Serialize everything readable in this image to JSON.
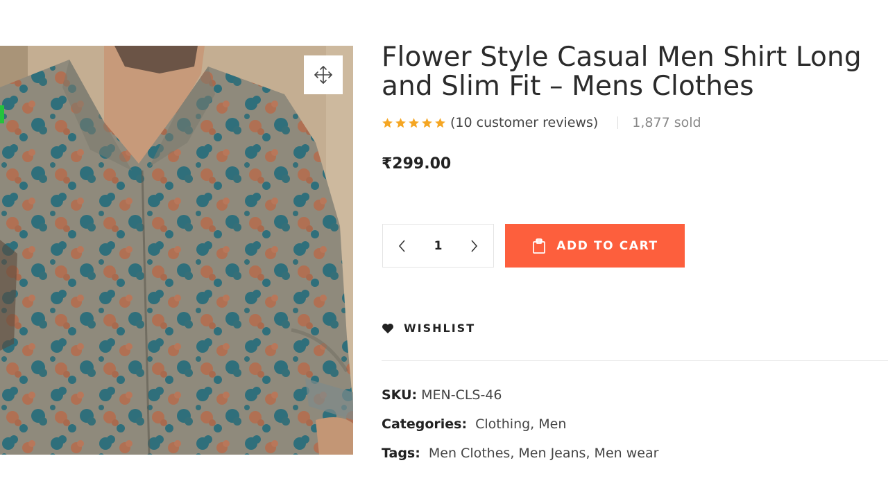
{
  "product": {
    "title_line1": "Flower Style Casual Men Shirt Long",
    "title_line2": "and Slim Fit – Mens Clothes",
    "rating": 5,
    "reviews_text": "(10 customer reviews)",
    "sold_text": "1,877 sold",
    "price": "₹299.00",
    "quantity": "1",
    "add_to_cart_label": "ADD TO CART",
    "wishlist_label": "WISHLIST",
    "sku_label": "SKU:",
    "sku_value": "MEN-CLS-46",
    "categories_label": "Categories:",
    "categories": [
      "Clothing",
      "Men"
    ],
    "tags_label": "Tags:",
    "tags": [
      "Men Clothes",
      "Men Jeans",
      "Men wear"
    ]
  },
  "icons": {
    "zoom": "move-arrows-icon",
    "star": "star-icon",
    "minus": "chevron-left-icon",
    "plus": "chevron-right-icon",
    "cart": "shopping-bag-icon",
    "heart": "heart-icon"
  },
  "colors": {
    "accent": "#fd5f3d",
    "star": "#f5a623",
    "sale_flag": "#25c33c"
  }
}
